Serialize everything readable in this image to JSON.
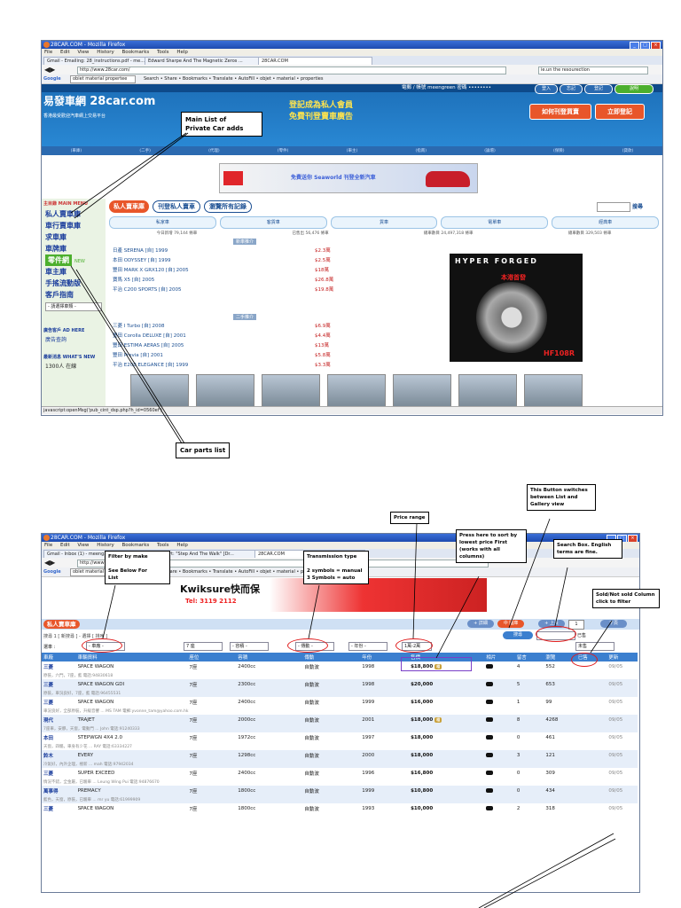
{
  "shot1": {
    "window_title": "28CAR.COM - Mozilla Firefox",
    "menu": [
      "File",
      "Edit",
      "View",
      "History",
      "Bookmarks",
      "Tools",
      "Help"
    ],
    "tabs": [
      "Gmail - Emailing: 28_instructions.pdf - me...",
      "Edward Sharpe And The Magnetic Zeros ...",
      "28CAR.COM"
    ],
    "url": "http://www.28car.com/",
    "search_text": "ie.un the resourection",
    "google_query": "obiet material propertee",
    "google_items": "Search • Share • Bookmarks • Translate • AutoFill • objet • material • properties",
    "login_label": "電郵 / 帳號 meengreen 密碼 ••••••••",
    "site_logo": "28car.com",
    "site_logo_cn": "易發車網",
    "site_tagline": "香港最受歡迎汽車網上交易平台",
    "promo_line1": "登記成為私人會員",
    "promo_line2": "免費刊登賣車廣告",
    "btn_how": "如何刊登買賣",
    "btn_register": "立即登記",
    "sidebar_header": "主目錄 MAIN MENU",
    "sidebar_items": [
      "私人賣車庫",
      "車行賣車庫",
      "求車庫",
      "車牌庫",
      "零件網",
      "車主庫",
      "手搖流動版",
      "客戶指南"
    ],
    "sidebar_new_badge": "NEW",
    "sidebar_select": "- 請選擇車類 -",
    "sidebar_ads": "廣告客戶 AD HERE",
    "sidebar_ads_link": "廣告查詢",
    "sidebar_news": "最新消息 WHAT'S NEW",
    "sidebar_news_item": "1300人 在線",
    "tabs_main": [
      "私人賣車庫",
      "刊登私人賣車",
      "瀏覽所有記錄"
    ],
    "search_button": "搜尋",
    "categories": [
      "私家車",
      "客貨車",
      "貨車",
      "電單車",
      "經典車"
    ],
    "counts": [
      "今日新增 79,144 條車",
      "已售出 56,476 條車",
      "總車數目 24,497,318 條車",
      "總車數目 329,503 條車"
    ],
    "banner_text": "免費送你 Seaworld 刊登全新汽車",
    "section_new": "新車推介",
    "section_used": "二手推介",
    "list_new": [
      {
        "name": "日產 SERENA [自] 1999",
        "price": "$2.3萬"
      },
      {
        "name": "本田 ODYSSEY [自] 1999",
        "price": "$2.5萬"
      },
      {
        "name": "豐田 MARK X GRX120 [自] 2005",
        "price": "$18萬"
      },
      {
        "name": "寶馬 X5 [自] 2005",
        "price": "$26.8萬"
      },
      {
        "name": "平治 C200 SPORTS [自] 2005",
        "price": "$19.8萬"
      }
    ],
    "list_used": [
      {
        "name": "三菱 I Turbo [自] 2008",
        "price": "$6.9萬"
      },
      {
        "name": "豐田 Corolla DELUXE [自] 2001",
        "price": "$4.4萬"
      },
      {
        "name": "豐田 ESTIMA AERAS [自] 2005",
        "price": "$13萬"
      },
      {
        "name": "豐田 Previa [自] 2001",
        "price": "$5.8萬"
      },
      {
        "name": "平治 E200 ELEGANCE [自] 1999",
        "price": "$3.3萬"
      }
    ],
    "ad_brand": "HYPER FORGED",
    "ad_model": "HF108R",
    "ad_cn": "本港首發",
    "statusbar": "javascript:openMsg('pub_cint_dsp.php?h_id=0560ef')"
  },
  "shot2": {
    "window_title": "28CAR.COM - Mozilla Firefox",
    "tabs": [
      "Gmail - Inbox (1) - meeng...",
      "...ute Sport: \"Step And The Walk\" [Dr...",
      "28CAR.COM"
    ],
    "url": "http://www",
    "banner_brand": "Kwiksure快而保",
    "banner_tel": "Tel: 3119 2112",
    "page_tab": "私人賣車庫",
    "buttons": [
      "+ 詳細",
      "中 圖庫",
      "+ 上頁"
    ],
    "page_num": "1",
    "next_label": "下頁",
    "breadcrumb": "搜尋 1 [ 新搜尋 ] - 選擇 [ 排序 ]",
    "filter_label": "選車 :",
    "filters": {
      "make": "- 車廠 -",
      "seats": "7 座",
      "engine": "- 容積 -",
      "transmission": "- 傳動 -",
      "year": "- 年份 -",
      "price": "1萬-2萬"
    },
    "search_label": "搜尋",
    "sold_label": "已售",
    "sold_select": "未售",
    "header": [
      "車廠",
      "車輛資料",
      "座位",
      "容積",
      "傳動",
      "年份",
      "售價",
      "相片",
      "留言",
      "瀏覽",
      "已售",
      "更新"
    ],
    "rows": [
      {
        "make": "三菱",
        "model": "SPACE WAGON",
        "seats": "7座",
        "cc": "2400cc",
        "trans": "自動波",
        "year": "1998",
        "price": "$18,800",
        "tag": true,
        "msg": "4",
        "views": "552",
        "date": "09/05",
        "desc": "原裝，六門，7座，藍 電話:94830618"
      },
      {
        "make": "三菱",
        "model": "SPACE WAGON GDI",
        "seats": "7座",
        "cc": "2300cc",
        "trans": "自動波",
        "year": "1998",
        "price": "$20,000",
        "tag": false,
        "msg": "5",
        "views": "653",
        "date": "09/05",
        "desc": "原裝，車況良好，7座，藍 電話:96455531"
      },
      {
        "make": "三菱",
        "model": "SPACE WAGON",
        "seats": "7座",
        "cc": "2400cc",
        "trans": "自動波",
        "year": "1999",
        "price": "$16,000",
        "tag": false,
        "msg": "1",
        "views": "99",
        "date": "09/05",
        "desc": "車況良好，全部原裝，升級音響 ... MS TAM 電郵:yvonne_tam@yahoo.com.hk"
      },
      {
        "make": "現代",
        "model": "TRAJET",
        "seats": "7座",
        "cc": "2000cc",
        "trans": "自動波",
        "year": "2001",
        "price": "$18,000",
        "tag": true,
        "msg": "8",
        "views": "4268",
        "date": "09/05",
        "desc": "7座車，安靜，天窗，電動門 ... John 電話:91240333"
      },
      {
        "make": "本田",
        "model": "STEPWGN 4X4 2.0",
        "seats": "7座",
        "cc": "1972cc",
        "trans": "自動波",
        "year": "1997",
        "price": "$18,000",
        "tag": false,
        "msg": "0",
        "views": "461",
        "date": "09/05",
        "desc": "天窗，四驅，車身有少花 ... RAY 電話:63334227"
      },
      {
        "make": "鈴木",
        "model": "EVERY",
        "seats": "7座",
        "cc": "1298cc",
        "trans": "自動波",
        "year": "2000",
        "price": "$18,000",
        "tag": false,
        "msg": "3",
        "views": "121",
        "date": "09/05",
        "desc": "冷氣好，內外企理，極新 ... mah 電話:97942034"
      },
      {
        "make": "三菱",
        "model": "SUPER EXCEED",
        "seats": "7座",
        "cc": "2400cc",
        "trans": "自動波",
        "year": "1996",
        "price": "$16,800",
        "tag": false,
        "msg": "0",
        "views": "309",
        "date": "09/05",
        "desc": "情況不錯，全金屬，已驗車 ... Leung Wing Pui 電話:94876670"
      },
      {
        "make": "萬事得",
        "model": "PREMACY",
        "seats": "7座",
        "cc": "1800cc",
        "trans": "自動波",
        "year": "1999",
        "price": "$10,800",
        "tag": false,
        "msg": "0",
        "views": "434",
        "date": "09/05",
        "desc": "藍色，天窗，原裝，已驗車 ... mr yu 電話:61999909"
      },
      {
        "make": "三菱",
        "model": "SPACE WAGON",
        "seats": "7座",
        "cc": "1800cc",
        "trans": "自動波",
        "year": "1993",
        "price": "$10,000",
        "tag": false,
        "msg": "2",
        "views": "318",
        "date": "09/05",
        "desc": ""
      }
    ]
  },
  "callouts": {
    "main_list": "Main List of\nPrivate Car adds",
    "car_parts": "Car parts list",
    "filter_make": "Filter by make\n\nSee Below For\nList",
    "transmission": "Transmission type\n\n2 symbols = manual\n3 Symbols = auto",
    "price_range": "Price range",
    "sort": "Press here to sort by\nlowest  price First\n(works with all\ncolumns)",
    "list_gallery": "This Button switches\nbetween List and\nGallery view",
    "search_box": "Search Box.  English\nterms are fine.",
    "sold_column": "Sold/Not sold Column\nclick to filter"
  },
  "colors": {
    "accent": "#2a8ad6",
    "highlight": "#e01b1b",
    "price_header": "#3b7fcf"
  }
}
